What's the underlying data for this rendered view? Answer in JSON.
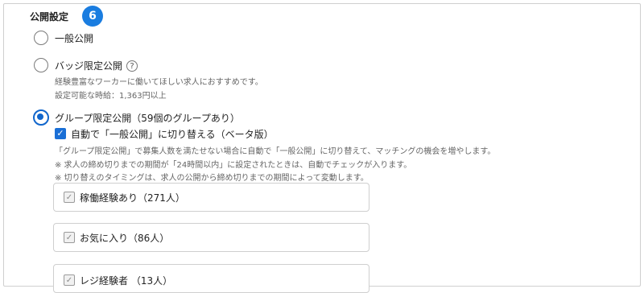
{
  "section": {
    "title": "公開設定",
    "step": "6"
  },
  "options": {
    "public": {
      "label": "一般公開"
    },
    "badge": {
      "label": "バッジ限定公開",
      "help": "?",
      "desc1": "経験豊富なワーカーに働いてほしい求人におすすめです。",
      "desc2": "設定可能な時給：1,363円以上"
    },
    "group": {
      "label": "グループ限定公開（59個のグループあり）",
      "auto_switch_label": "自動で「一般公開」に切り替える（ベータ版）",
      "note1": "「グループ限定公開」で募集人数を満たせない場合に自動で「一般公開」に切り替えて、マッチングの機会を増やします。",
      "note2": "※ 求人の締め切りまでの期間が「24時間以内」に設定されたときは、自動でチェックが入ります。",
      "note3": "※ 切り替えのタイミングは、求人の公開から締め切りまでの期間によって変動します。"
    }
  },
  "groups": [
    {
      "label": "稼働経験あり（271人）"
    },
    {
      "label": "お気に入り（86人）"
    },
    {
      "label": "レジ経験者 （13人）"
    }
  ],
  "icons": {
    "check": "✓"
  },
  "colors": {
    "accent": "#1a7de0",
    "selected": "#1166cc"
  }
}
